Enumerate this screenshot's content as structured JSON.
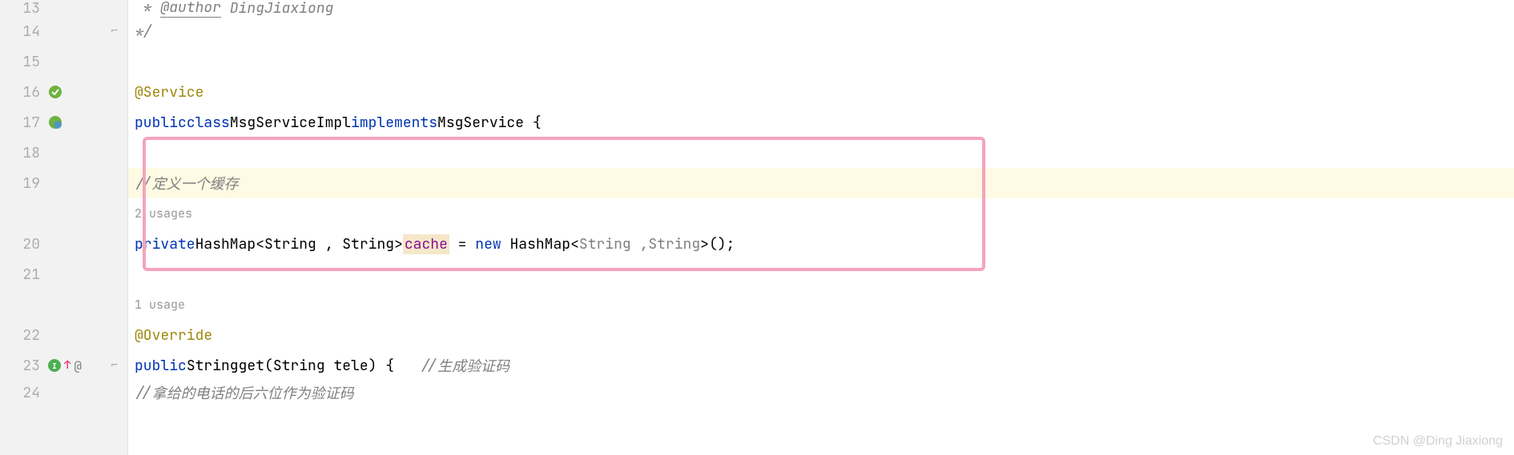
{
  "gutter": {
    "lines": [
      "13",
      "14",
      "15",
      "16",
      "17",
      "18",
      "19",
      "",
      "20",
      "21",
      "",
      "22",
      "23",
      "24"
    ]
  },
  "code": {
    "line13_author": "@author",
    "line13_name": "DingJiaxiong",
    "line14_comment": "*/",
    "line16_annotation": "@Service",
    "line17_public": "public",
    "line17_class": "class",
    "line17_name": "MsgServiceImpl",
    "line17_implements": "implements",
    "line17_interface": "MsgService",
    "line17_brace": " {",
    "line19_comment_slash": "//",
    "line19_comment_text": "定义一个缓存",
    "usages_hint1": "2 usages",
    "line20_private": "private",
    "line20_hashmap": "HashMap",
    "line20_generic_open": "<",
    "line20_string1": "String",
    "line20_comma1": " , ",
    "line20_string2": "String",
    "line20_generic_close": ">",
    "line20_cache": "cache",
    "line20_equals": " = ",
    "line20_new": "new",
    "line20_hashmap2": " HashMap",
    "line20_generic2_open": "<",
    "line20_string3": "String",
    "line20_comma2": " ,",
    "line20_string4": "String",
    "line20_generic2_close": ">",
    "line20_paren": "();",
    "usages_hint2": "1 usage",
    "line22_override": "@Override",
    "line23_public": "public",
    "line23_string": "String",
    "line23_get": "get",
    "line23_paren_open": "(",
    "line23_param_type": "String",
    "line23_param_name": " tele",
    "line23_paren_close": ")",
    "line23_brace": " {",
    "line23_comment_slash": "   //",
    "line23_comment_text": "生成验证码",
    "line24_comment_slash": "//",
    "line24_comment_text": "拿给的电话的后六位作为验证码"
  },
  "watermark": "CSDN @Ding Jiaxiong"
}
